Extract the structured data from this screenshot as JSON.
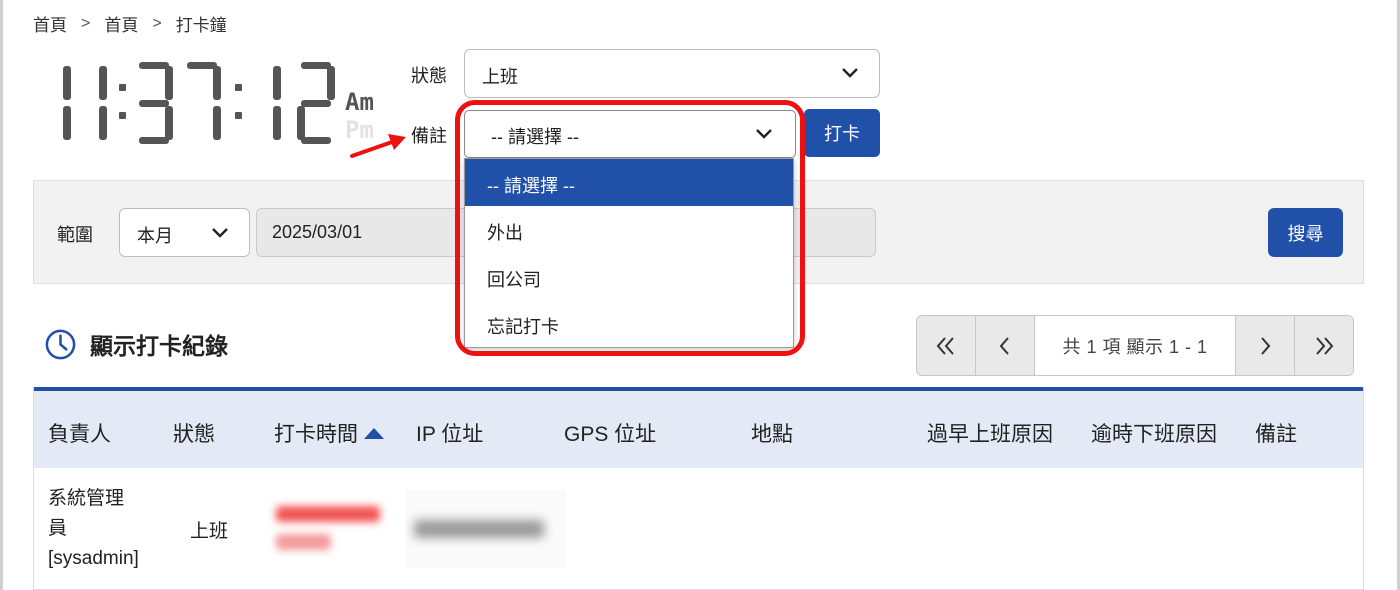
{
  "breadcrumb": {
    "items": [
      "首頁",
      "首頁",
      "打卡鐘"
    ],
    "separator": ">"
  },
  "clock": {
    "time": "11:37:12",
    "am": "Am",
    "pm": "Pm"
  },
  "form": {
    "status_label": "狀態",
    "status_value": "上班",
    "note_label": "備註",
    "note_value": "-- 請選擇 --",
    "note_options": [
      "-- 請選擇 --",
      "外出",
      "回公司",
      "忘記打卡"
    ],
    "punch_button": "打卡"
  },
  "filter": {
    "range_label": "範圍",
    "range_value": "本月",
    "date_value": "2025/03/01",
    "search_button": "搜尋"
  },
  "records": {
    "title": "顯示打卡紀錄",
    "pager_info": "共 1 項 顯示 1 - 1",
    "columns": [
      "負責人",
      "狀態",
      "打卡時間",
      "IP 位址",
      "GPS 位址",
      "地點",
      "過早上班原因",
      "逾時下班原因",
      "備註"
    ],
    "rows": [
      {
        "owner_line1": "系統管理",
        "owner_line2": "員",
        "owner_line3": "[sysadmin]",
        "status": "上班"
      }
    ]
  },
  "colors": {
    "primary": "#2050a8",
    "highlight": "#ee1111",
    "header_bg": "#e4eaf5"
  },
  "icons": [
    "chevron-down-icon",
    "clock-icon",
    "first-page-icon",
    "prev-page-icon",
    "next-page-icon",
    "last-page-icon",
    "sort-ascending-icon",
    "red-arrow-annotation"
  ]
}
